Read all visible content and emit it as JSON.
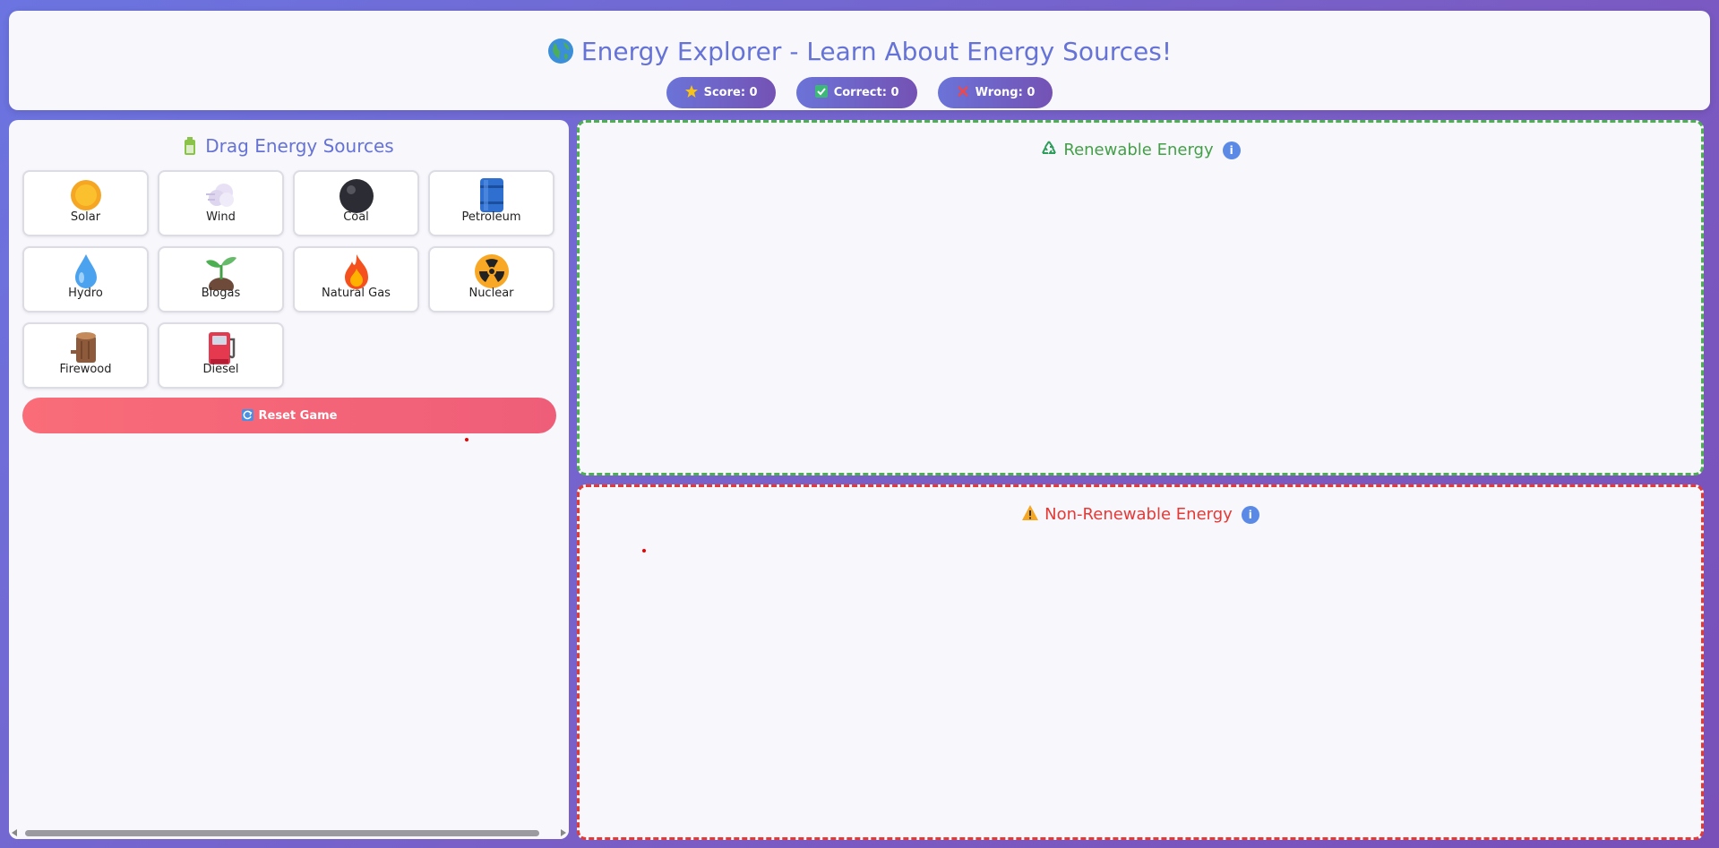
{
  "header": {
    "title": "Energy Explorer - Learn About Energy Sources!",
    "stats": [
      {
        "label": "Score: 0",
        "icon": "star-icon"
      },
      {
        "label": "Correct: 0",
        "icon": "check-icon"
      },
      {
        "label": "Wrong: 0",
        "icon": "cross-icon"
      }
    ]
  },
  "sources_panel": {
    "title": "Drag Energy Sources",
    "cards": [
      {
        "label": "Solar",
        "icon": "sun-icon"
      },
      {
        "label": "Wind",
        "icon": "wind-icon"
      },
      {
        "label": "Coal",
        "icon": "coal-icon"
      },
      {
        "label": "Petroleum",
        "icon": "oil-barrel-icon"
      },
      {
        "label": "Hydro",
        "icon": "water-drop-icon"
      },
      {
        "label": "Biogas",
        "icon": "sprout-icon"
      },
      {
        "label": "Natural Gas",
        "icon": "flame-icon"
      },
      {
        "label": "Nuclear",
        "icon": "radiation-icon"
      },
      {
        "label": "Firewood",
        "icon": "log-icon"
      },
      {
        "label": "Diesel",
        "icon": "fuel-pump-icon"
      }
    ],
    "reset_label": "Reset Game"
  },
  "zones": {
    "renewable": {
      "title": "Renewable Energy",
      "color": "#4caf50"
    },
    "non_renewable": {
      "title": "Non-Renewable Energy",
      "color": "#e53935"
    }
  },
  "colors": {
    "accent": "#6673d6",
    "reset": "#f96c78"
  }
}
